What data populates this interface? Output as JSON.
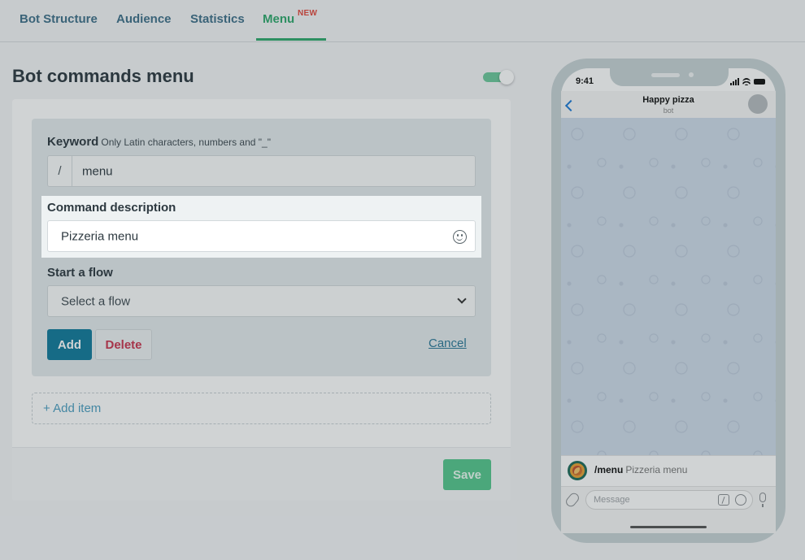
{
  "tabs": [
    {
      "label": "Bot Structure"
    },
    {
      "label": "Audience"
    },
    {
      "label": "Statistics"
    },
    {
      "label": "Menu",
      "badge": "NEW"
    }
  ],
  "page": {
    "title": "Bot commands menu",
    "enabled": true
  },
  "form": {
    "keyword_label": "Keyword",
    "keyword_hint": "Only Latin characters, numbers and \"_\"",
    "keyword_prefix": "/",
    "keyword_value": "menu",
    "description_label": "Command description",
    "description_value": "Pizzeria menu",
    "flow_label": "Start a flow",
    "flow_value": "Select a flow",
    "add_label": "Add",
    "delete_label": "Delete",
    "cancel_label": "Cancel"
  },
  "add_item_label": "+ Add item",
  "save_label": "Save",
  "phone": {
    "time": "9:41",
    "chat_title": "Happy pizza",
    "chat_subtitle": "bot",
    "command": "/menu",
    "command_desc": "Pizzeria menu",
    "message_placeholder": "Message"
  },
  "colors": {
    "accent": "#2fa86c",
    "primary_button": "#117a9b",
    "delete_text": "#c9354f",
    "link": "#2b7898"
  }
}
